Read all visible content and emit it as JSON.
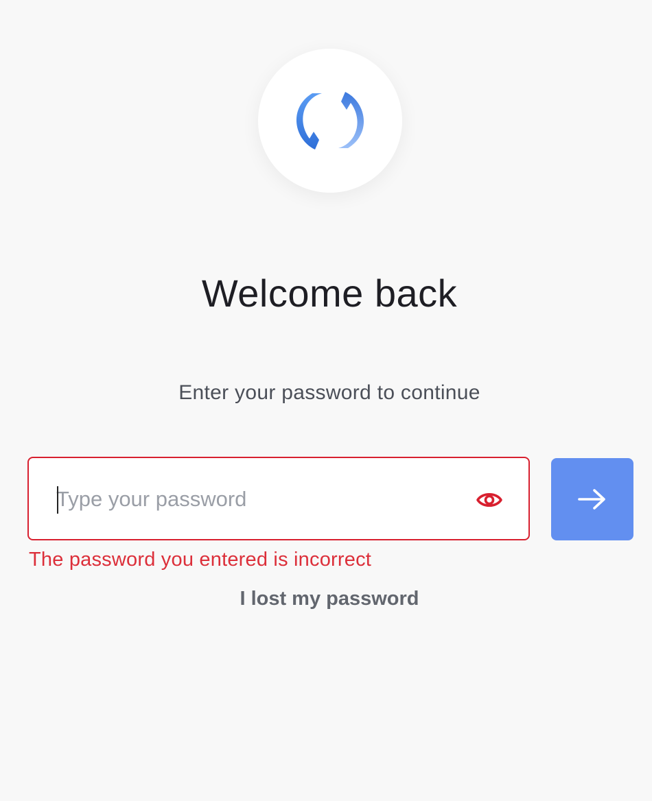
{
  "logo": {
    "icon": "refresh-sync-logo-icon",
    "colors": {
      "primary": "#3d7fe6",
      "secondary": "#8fb6f7"
    }
  },
  "heading": {
    "title": "Welcome back",
    "subtitle": "Enter your password to continue"
  },
  "password": {
    "placeholder": "Type your password",
    "value": "",
    "toggle_icon": "eye-icon",
    "error": "The password you entered is incorrect"
  },
  "submit": {
    "icon": "arrow-right-icon"
  },
  "links": {
    "lost_password": "I lost my password"
  },
  "colors": {
    "error": "#d8202f",
    "accent": "#628ff0",
    "background": "#f8f8f8"
  }
}
